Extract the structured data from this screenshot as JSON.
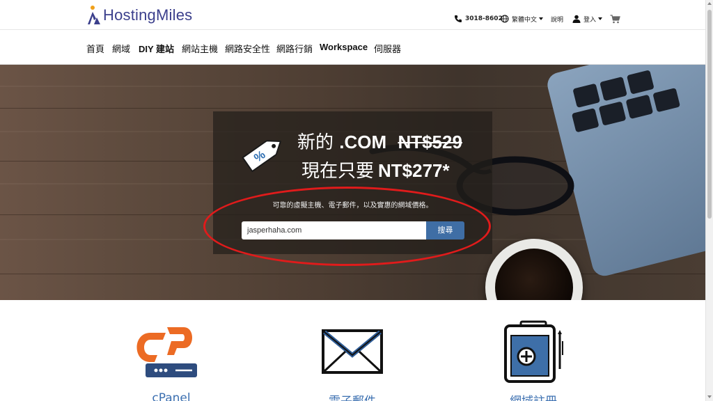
{
  "brand": {
    "name": "HostingMiles",
    "text_color": "#3b3f8c",
    "accent": "#f0a019"
  },
  "utility": {
    "phone": "3018-8602",
    "language": "繁體中文",
    "help": "說明",
    "login": "登入"
  },
  "nav": {
    "items": [
      {
        "label": "首頁",
        "bold": false
      },
      {
        "label": "網域",
        "bold": false
      },
      {
        "label": "DIY 建站",
        "bold": true
      },
      {
        "label": "網站主機",
        "bold": false
      },
      {
        "label": "網路安全性",
        "bold": false
      },
      {
        "label": "網路行銷",
        "bold": false
      },
      {
        "label": "Workspace",
        "bold": true
      },
      {
        "label": "伺服器",
        "bold": false
      }
    ]
  },
  "hero": {
    "line1_prefix": "新的",
    "line1_tld": ".COM",
    "line1_old_price": "NT$529",
    "line2_prefix": "現在只要",
    "line2_new_price": "NT$277*",
    "subtitle": "可靠的虛擬主機、電子郵件，以及實惠的網域價格。",
    "search_value": "jasperhaha.com",
    "search_button": "搜尋",
    "button_color": "#3f6ea5",
    "highlight_color": "#e01b1b"
  },
  "features": [
    {
      "label": "cPanel",
      "icon": "cpanel-icon"
    },
    {
      "label": "電子郵件",
      "icon": "envelope-icon"
    },
    {
      "label": "網域註冊",
      "icon": "domain-registration-icon"
    }
  ]
}
